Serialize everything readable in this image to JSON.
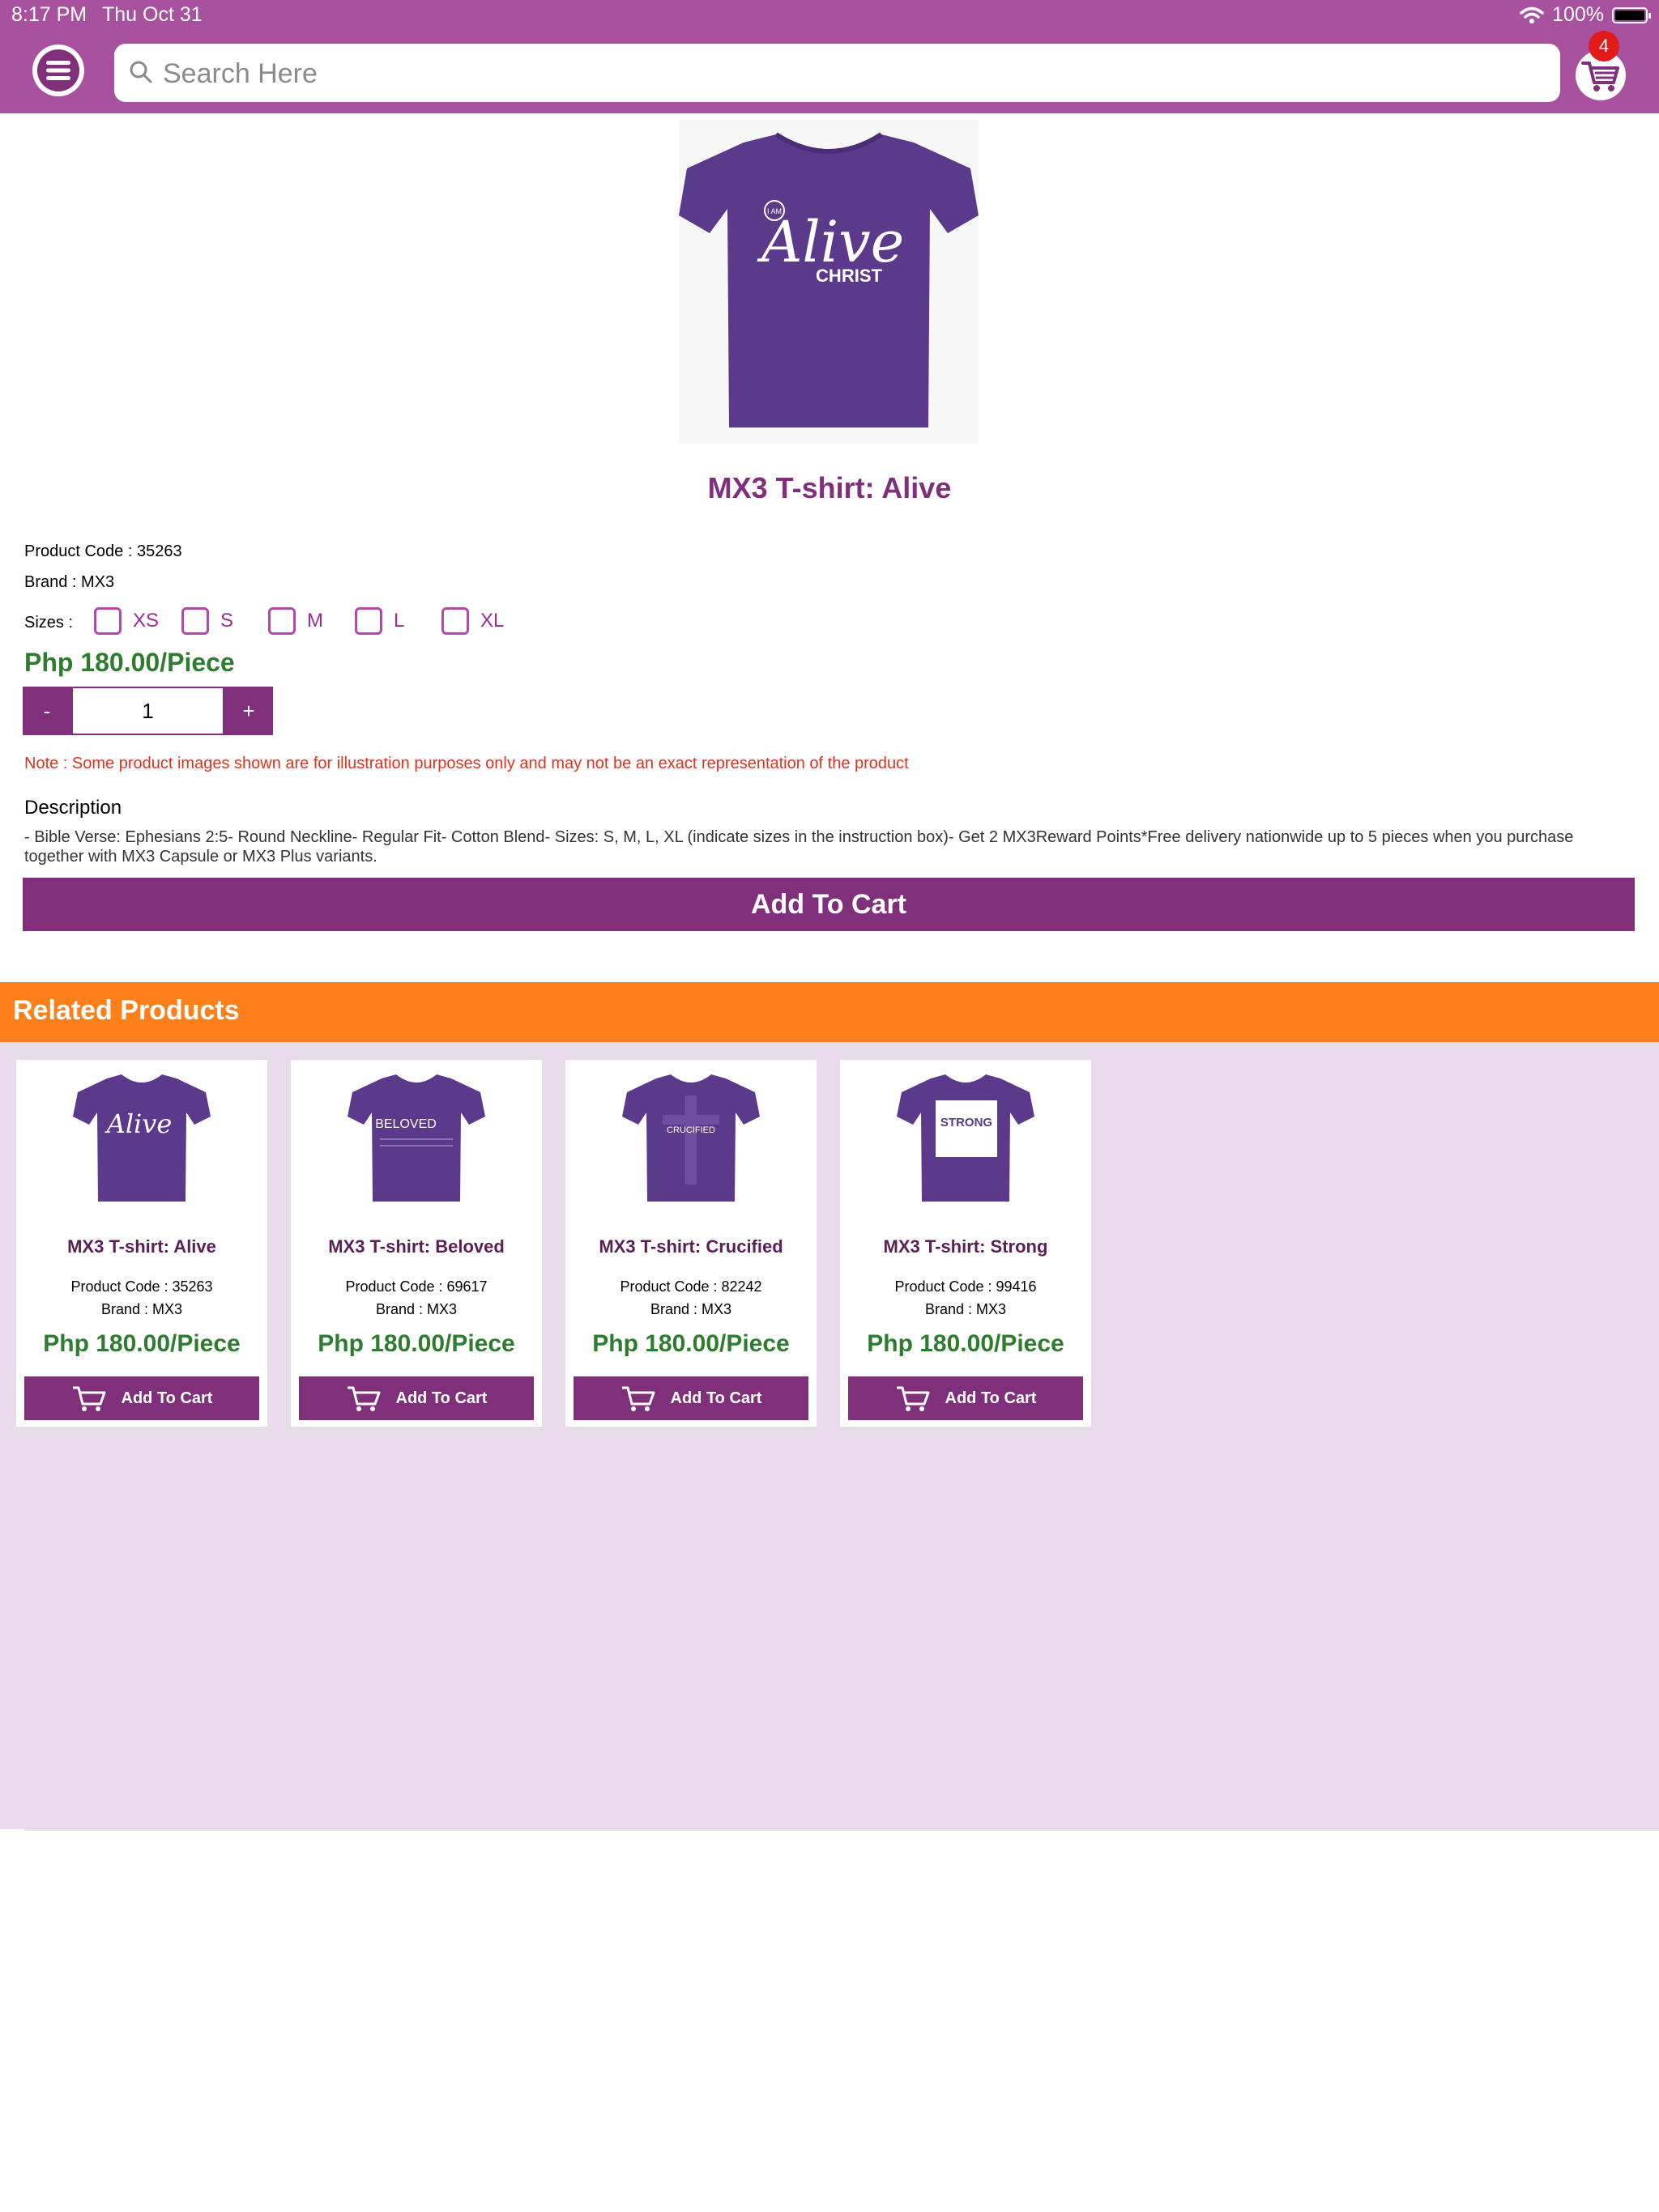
{
  "status_bar": {
    "time": "8:17 PM",
    "date": "Thu Oct 31",
    "battery": "100%"
  },
  "header": {
    "search_placeholder": "Search Here",
    "cart_count": "4",
    "menu_icon": "hamburger-menu-icon",
    "cart_icon": "shopping-cart-icon"
  },
  "product": {
    "title": "MX3 T-shirt: Alive",
    "code": "Product Code : 35263",
    "brand": "Brand : MX3",
    "sizes_label": "Sizes :",
    "sizes": [
      "XS",
      "S",
      "M",
      "L",
      "XL"
    ],
    "price": "Php 180.00/Piece",
    "qty_minus": "-",
    "qty_plus": "+",
    "qty_value": "1",
    "note": "Note : Some product images shown are for illustration purposes only and may not be an exact representation of the product",
    "description_heading": "Description",
    "description": "- Bible Verse: Ephesians 2:5- Round Neckline- Regular Fit- Cotton Blend- Sizes: S, M, L, XL (indicate sizes in the instruction box)- Get 2 MX3Reward Points*Free delivery nationwide up to 5 pieces when you purchase together with MX3 Capsule or MX3 Plus variants.",
    "add_to_cart": "Add To Cart",
    "shirt_print": {
      "top": "I AM",
      "main": "Alive",
      "bottom": "CHRIST"
    }
  },
  "related": {
    "heading": "Related Products",
    "items": [
      {
        "name": "MX3 T-shirt: Alive",
        "code": "Product Code : 35263",
        "brand": "Brand : MX3",
        "price": "Php 180.00/Piece",
        "button": "Add To Cart",
        "print": "Alive"
      },
      {
        "name": "MX3 T-shirt: Beloved",
        "code": "Product Code : 69617",
        "brand": "Brand : MX3",
        "price": "Php 180.00/Piece",
        "button": "Add To Cart",
        "print": "BELOVED"
      },
      {
        "name": "MX3 T-shirt: Crucified",
        "code": "Product Code : 82242",
        "brand": "Brand : MX3",
        "price": "Php 180.00/Piece",
        "button": "Add To Cart",
        "print": "CRUCIFIED"
      },
      {
        "name": "MX3 T-shirt: Strong",
        "code": "Product Code : 99416",
        "brand": "Brand : MX3",
        "price": "Php 180.00/Piece",
        "button": "Add To Cart",
        "print": "STRONG"
      }
    ]
  },
  "colors": {
    "header": "#a8519f",
    "primary": "#80307a",
    "price": "#2e7d2e",
    "related_bar": "#ff7f1a",
    "related_bg": "#e8dbea",
    "note": "#e0311e",
    "shirt": "#5b3a8c"
  }
}
